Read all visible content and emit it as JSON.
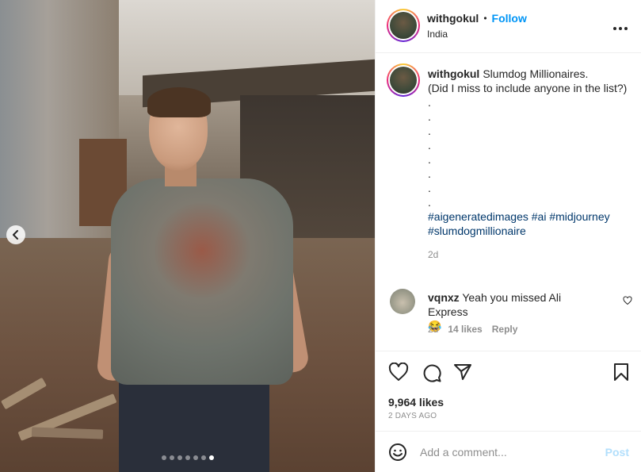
{
  "post": {
    "username": "withgokul",
    "follow_label": "Follow",
    "separator": "•",
    "location": "India",
    "more_label": "•••"
  },
  "caption": {
    "username": "withgokul",
    "text": "Slumdog Millionaires.",
    "line2": "(Did I miss to include anyone in the list?)",
    "dots": [
      ".",
      ".",
      ".",
      ".",
      ".",
      ".",
      ".",
      "."
    ],
    "hashtags": [
      "#aigeneratedimages",
      "#ai",
      "#midjourney",
      "#slumdogmillionaire"
    ],
    "time": "2d"
  },
  "comment": {
    "username": "vqnxz",
    "text": "Yeah you missed Ali Express",
    "emoji": "😂",
    "time": "2d",
    "likes": "14 likes",
    "reply_label": "Reply"
  },
  "stats": {
    "likes": "9,964 likes",
    "date": "2 DAYS AGO"
  },
  "add_comment": {
    "placeholder": "Add a comment...",
    "post_label": "Post"
  },
  "carousel": {
    "dot_count": 7,
    "active_index": 6
  },
  "colors": {
    "link": "#0095f6",
    "hashtag": "#00376b",
    "muted": "#8e8e8e",
    "post_disabled": "#b2dffc"
  },
  "icons": [
    "chevron-left-icon",
    "more-icon",
    "heart-icon",
    "comment-icon",
    "share-icon",
    "bookmark-icon",
    "emoji-icon"
  ]
}
